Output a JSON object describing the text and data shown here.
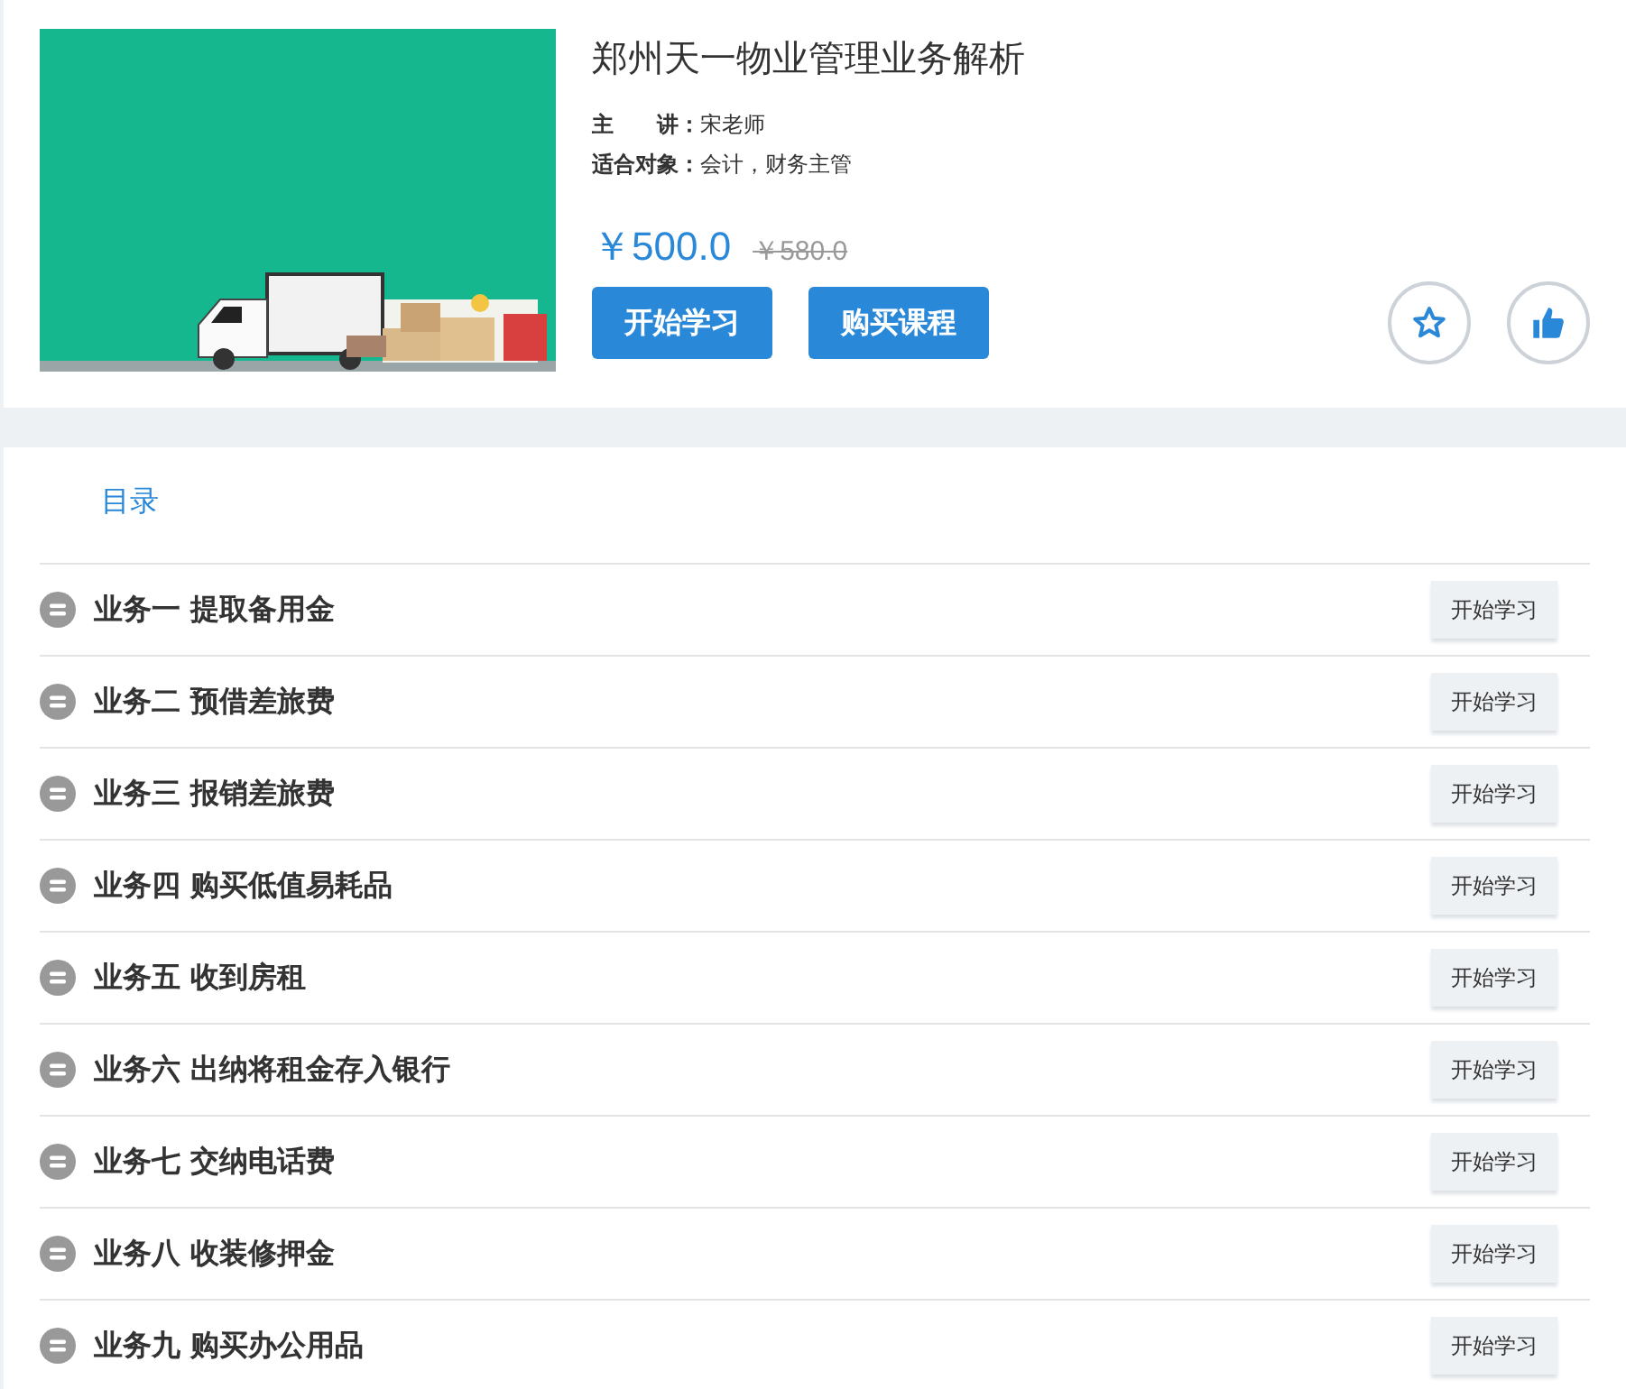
{
  "course": {
    "title": "郑州天一物业管理业务解析",
    "meta": [
      {
        "label": "主　　讲：",
        "value": "宋老师"
      },
      {
        "label": "适合对象：",
        "value": "会计，财务主管"
      }
    ],
    "price": "￥500.0",
    "original_price": "￥580.0",
    "buttons": [
      "开始学习",
      "购买课程"
    ]
  },
  "catalog": {
    "heading": "目录",
    "lessons": [
      {
        "title": "业务一 提取备用金",
        "button": "开始学习"
      },
      {
        "title": "业务二 预借差旅费",
        "button": "开始学习"
      },
      {
        "title": "业务三 报销差旅费",
        "button": "开始学习"
      },
      {
        "title": "业务四 购买低值易耗品",
        "button": "开始学习"
      },
      {
        "title": "业务五 收到房租",
        "button": "开始学习"
      },
      {
        "title": "业务六 出纳将租金存入银行",
        "button": "开始学习"
      },
      {
        "title": "业务七 交纳电话费",
        "button": "开始学习"
      },
      {
        "title": "业务八 收装修押金",
        "button": "开始学习"
      },
      {
        "title": "业务九 购买办公用品",
        "button": "开始学习"
      }
    ]
  }
}
